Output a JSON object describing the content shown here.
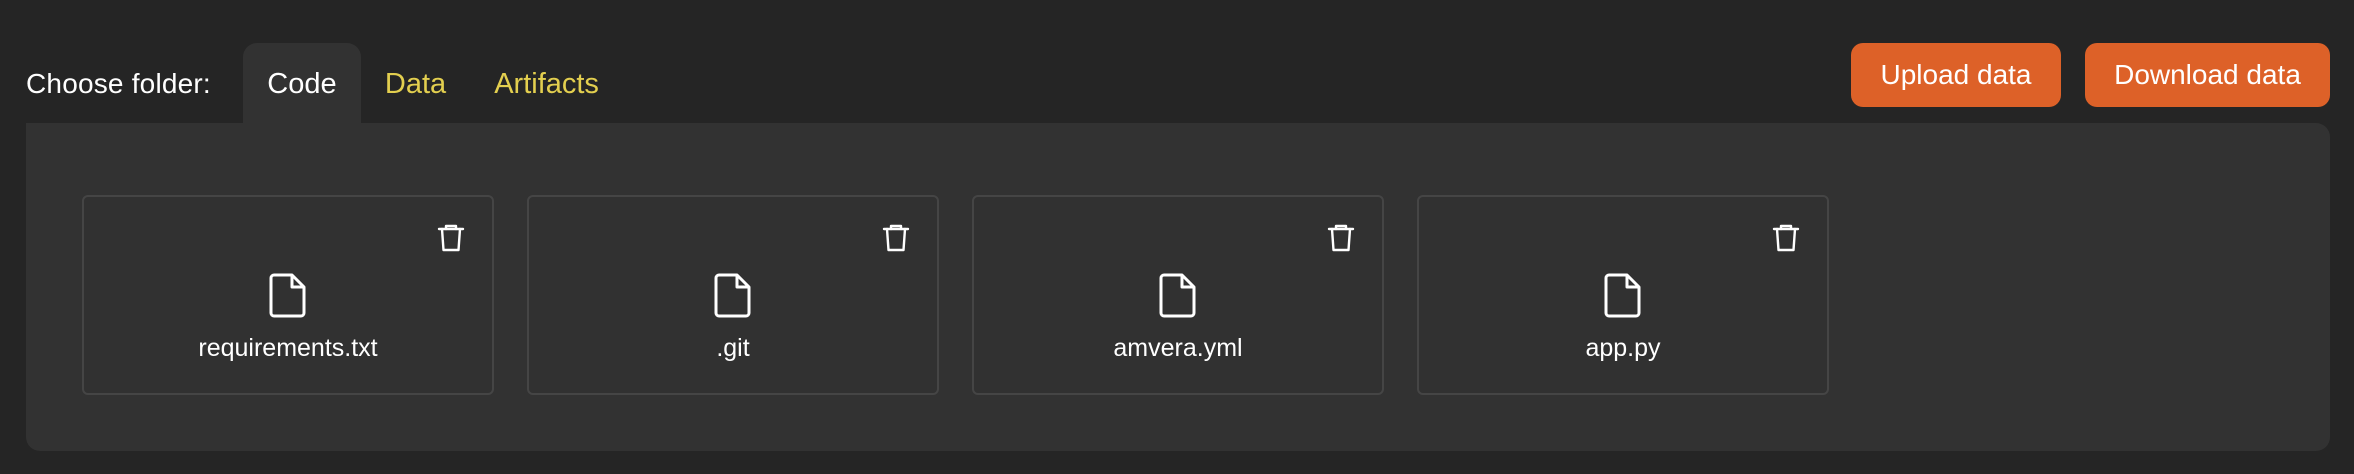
{
  "header": {
    "choose_label": "Choose folder:",
    "tabs": [
      {
        "label": "Code",
        "active": true
      },
      {
        "label": "Data",
        "active": false
      },
      {
        "label": "Artifacts",
        "active": false
      }
    ]
  },
  "actions": {
    "upload_label": "Upload data",
    "download_label": "Download data"
  },
  "files": [
    {
      "name": "requirements.txt",
      "icon": "file-icon",
      "action_icon": "trash-icon"
    },
    {
      "name": ".git",
      "icon": "file-icon",
      "action_icon": "trash-icon"
    },
    {
      "name": "amvera.yml",
      "icon": "file-icon",
      "action_icon": "trash-icon"
    },
    {
      "name": "app.py",
      "icon": "file-icon",
      "action_icon": "trash-icon"
    }
  ],
  "colors": {
    "background": "#252525",
    "panel": "#323232",
    "accent_button": "#dd6128",
    "inactive_tab": "#e3cf4f",
    "text": "#ffffff"
  }
}
